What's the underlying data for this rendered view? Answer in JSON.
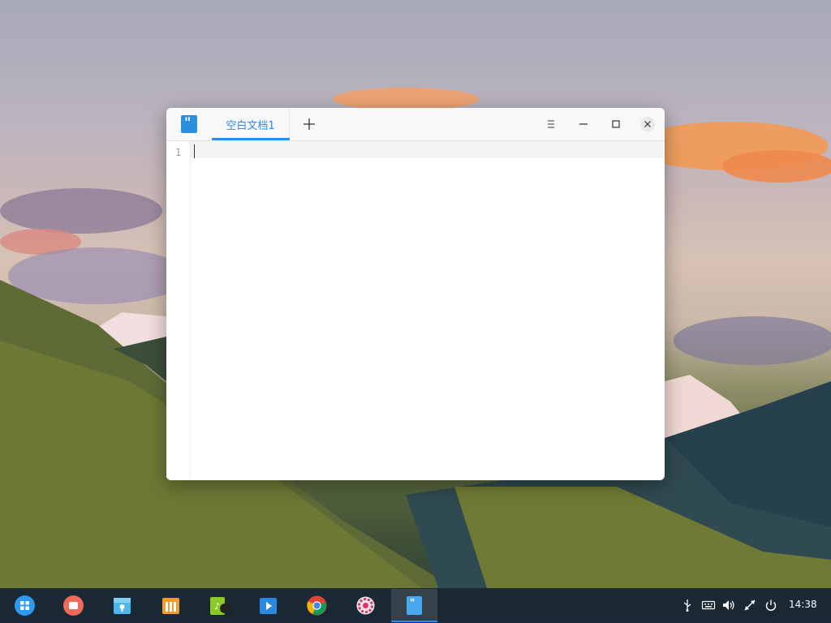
{
  "editor": {
    "tab_title": "空白文档1",
    "line_numbers": [
      "1"
    ],
    "content": ""
  },
  "titlebar": {
    "app_icon": "text-editor-icon",
    "add_tab_icon": "plus-icon",
    "menu_icon": "hamburger-menu-icon",
    "minimize_icon": "minimize-icon",
    "maximize_icon": "maximize-icon",
    "close_icon": "close-icon"
  },
  "dock": {
    "apps": [
      {
        "name": "launcher",
        "icon": "launcher-icon"
      },
      {
        "name": "screen-recorder",
        "icon": "record-icon"
      },
      {
        "name": "file-manager",
        "icon": "file-manager-icon"
      },
      {
        "name": "app-store",
        "icon": "store-icon"
      },
      {
        "name": "music",
        "icon": "music-icon"
      },
      {
        "name": "movie",
        "icon": "video-icon"
      },
      {
        "name": "chrome",
        "icon": "chrome-icon"
      },
      {
        "name": "settings",
        "icon": "gear-icon"
      },
      {
        "name": "text-editor",
        "icon": "text-editor-icon"
      }
    ],
    "tray": [
      "usb-icon",
      "keyboard-icon",
      "volume-icon",
      "network-icon",
      "power-icon"
    ],
    "clock": "14:38"
  },
  "colors": {
    "accent": "#2c8ee6",
    "dock_bg": "#142332"
  }
}
